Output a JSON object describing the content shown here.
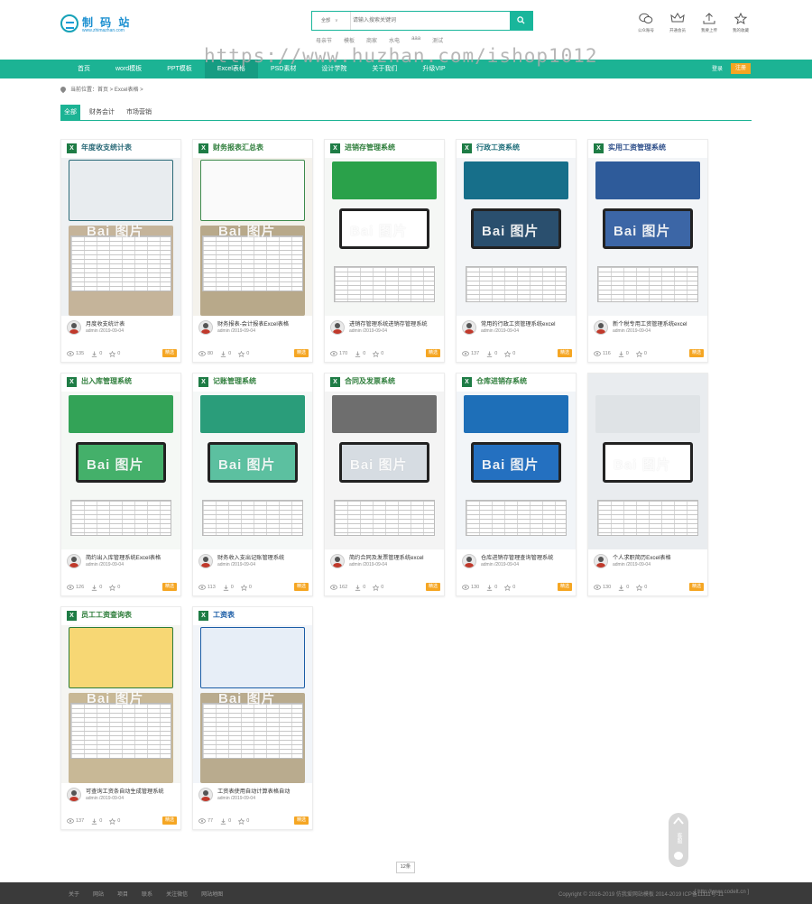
{
  "header": {
    "logo_name": "制 码 站",
    "logo_sub": "www.zhimazhan.com",
    "search": {
      "category": "全部",
      "placeholder": "请输入搜索关键词",
      "value": ""
    },
    "hot_words": [
      "母亲节",
      "模板",
      "商家",
      "水电",
      "aaa",
      "测试"
    ],
    "icons": [
      {
        "icon": "wechat-icon",
        "label": "公众账号"
      },
      {
        "icon": "crown-icon",
        "label": "开通会员"
      },
      {
        "icon": "upload-icon",
        "label": "我要上传"
      },
      {
        "icon": "star-icon",
        "label": "我的收藏"
      }
    ],
    "watermark": "https://www.huzhan.com/ishop1012"
  },
  "nav": {
    "items": [
      "首页",
      "word模板",
      "PPT模板",
      "Excel表格",
      "PSD素材",
      "设计学院",
      "关于我们",
      "升级VIP"
    ],
    "active_index": 3,
    "login": "登录",
    "register": "注册"
  },
  "breadcrumb": {
    "text": "当前位置：首页 > Excel表格 >"
  },
  "subtabs": {
    "items": [
      "全部",
      "财务会计",
      "市场营销"
    ],
    "active_index": 0
  },
  "colors": {
    "accent": "#1cb394",
    "orange": "#f5a623",
    "footer_bg": "#3a3a3a"
  },
  "cards": [
    {
      "thumb_title": "年度收支统计表",
      "title": "月度收支统计表",
      "author": "admin",
      "date": "2019-09-04",
      "views": "135",
      "downloads": "0",
      "likes": "0",
      "btn": "精选"
    },
    {
      "thumb_title": "财务报表汇总表",
      "title": "财务报表-会计报表Excel表格",
      "author": "admin",
      "date": "2019-09-04",
      "views": "80",
      "downloads": "0",
      "likes": "0",
      "btn": "精选"
    },
    {
      "thumb_title": "进销存管理系统",
      "title": "进销存管理系统进销存管理系统",
      "author": "admin",
      "date": "2019-09-04",
      "views": "170",
      "downloads": "0",
      "likes": "0",
      "btn": "精选"
    },
    {
      "thumb_title": "行政工资系统",
      "title": "常用的行政工资管理系统excel",
      "author": "admin",
      "date": "2019-09-04",
      "views": "137",
      "downloads": "0",
      "likes": "0",
      "btn": "精选"
    },
    {
      "thumb_title": "实用工资管理系统",
      "title": "新个税专用工资管理系统excel",
      "author": "admin",
      "date": "2019-09-04",
      "views": "116",
      "downloads": "0",
      "likes": "0",
      "btn": "精选"
    },
    {
      "thumb_title": "出入库管理系统",
      "title": "简约出入库管理系统Excel表格",
      "author": "admin",
      "date": "2019-09-04",
      "views": "126",
      "downloads": "0",
      "likes": "0",
      "btn": "精选"
    },
    {
      "thumb_title": "记账管理系统",
      "title": "财务收入支出记账管理系统",
      "author": "admin",
      "date": "2019-09-04",
      "views": "113",
      "downloads": "0",
      "likes": "0",
      "btn": "精选"
    },
    {
      "thumb_title": "合同及发票系统",
      "title": "简约合同及发票管理系统excel",
      "author": "admin",
      "date": "2019-09-04",
      "views": "162",
      "downloads": "0",
      "likes": "0",
      "btn": "精选"
    },
    {
      "thumb_title": "仓库进销存系统",
      "title": "仓库进销存管理查询管理系统",
      "author": "admin",
      "date": "2019-09-04",
      "views": "130",
      "downloads": "0",
      "likes": "0",
      "btn": "精选"
    },
    {
      "thumb_title": "",
      "title": "个人求职简历Excel表格",
      "author": "admin",
      "date": "2019-09-04",
      "views": "130",
      "downloads": "0",
      "likes": "0",
      "btn": "精选"
    },
    {
      "thumb_title": "员工工资查询表",
      "title": "可查询工资条自动生成管理系统",
      "author": "admin",
      "date": "2019-09-04",
      "views": "137",
      "downloads": "0",
      "likes": "0",
      "btn": "精选"
    },
    {
      "thumb_title": "工资表",
      "title": "工资表使用自动计算表格自动",
      "author": "admin",
      "date": "2019-09-04",
      "views": "77",
      "downloads": "0",
      "likes": "0",
      "btn": "精选"
    }
  ],
  "pager": {
    "total": "12条"
  },
  "floatbar": {
    "label": "客服"
  },
  "footer": {
    "links": [
      "关于",
      "网站",
      "项目",
      "联系",
      "关注微信",
      "网站地图"
    ],
    "copyright": "Copyright © 2016-2019 仿我爱网站模板 2014-2019 ICP备11111号-11",
    "site": "[ http://www.codelt.cn ]"
  }
}
